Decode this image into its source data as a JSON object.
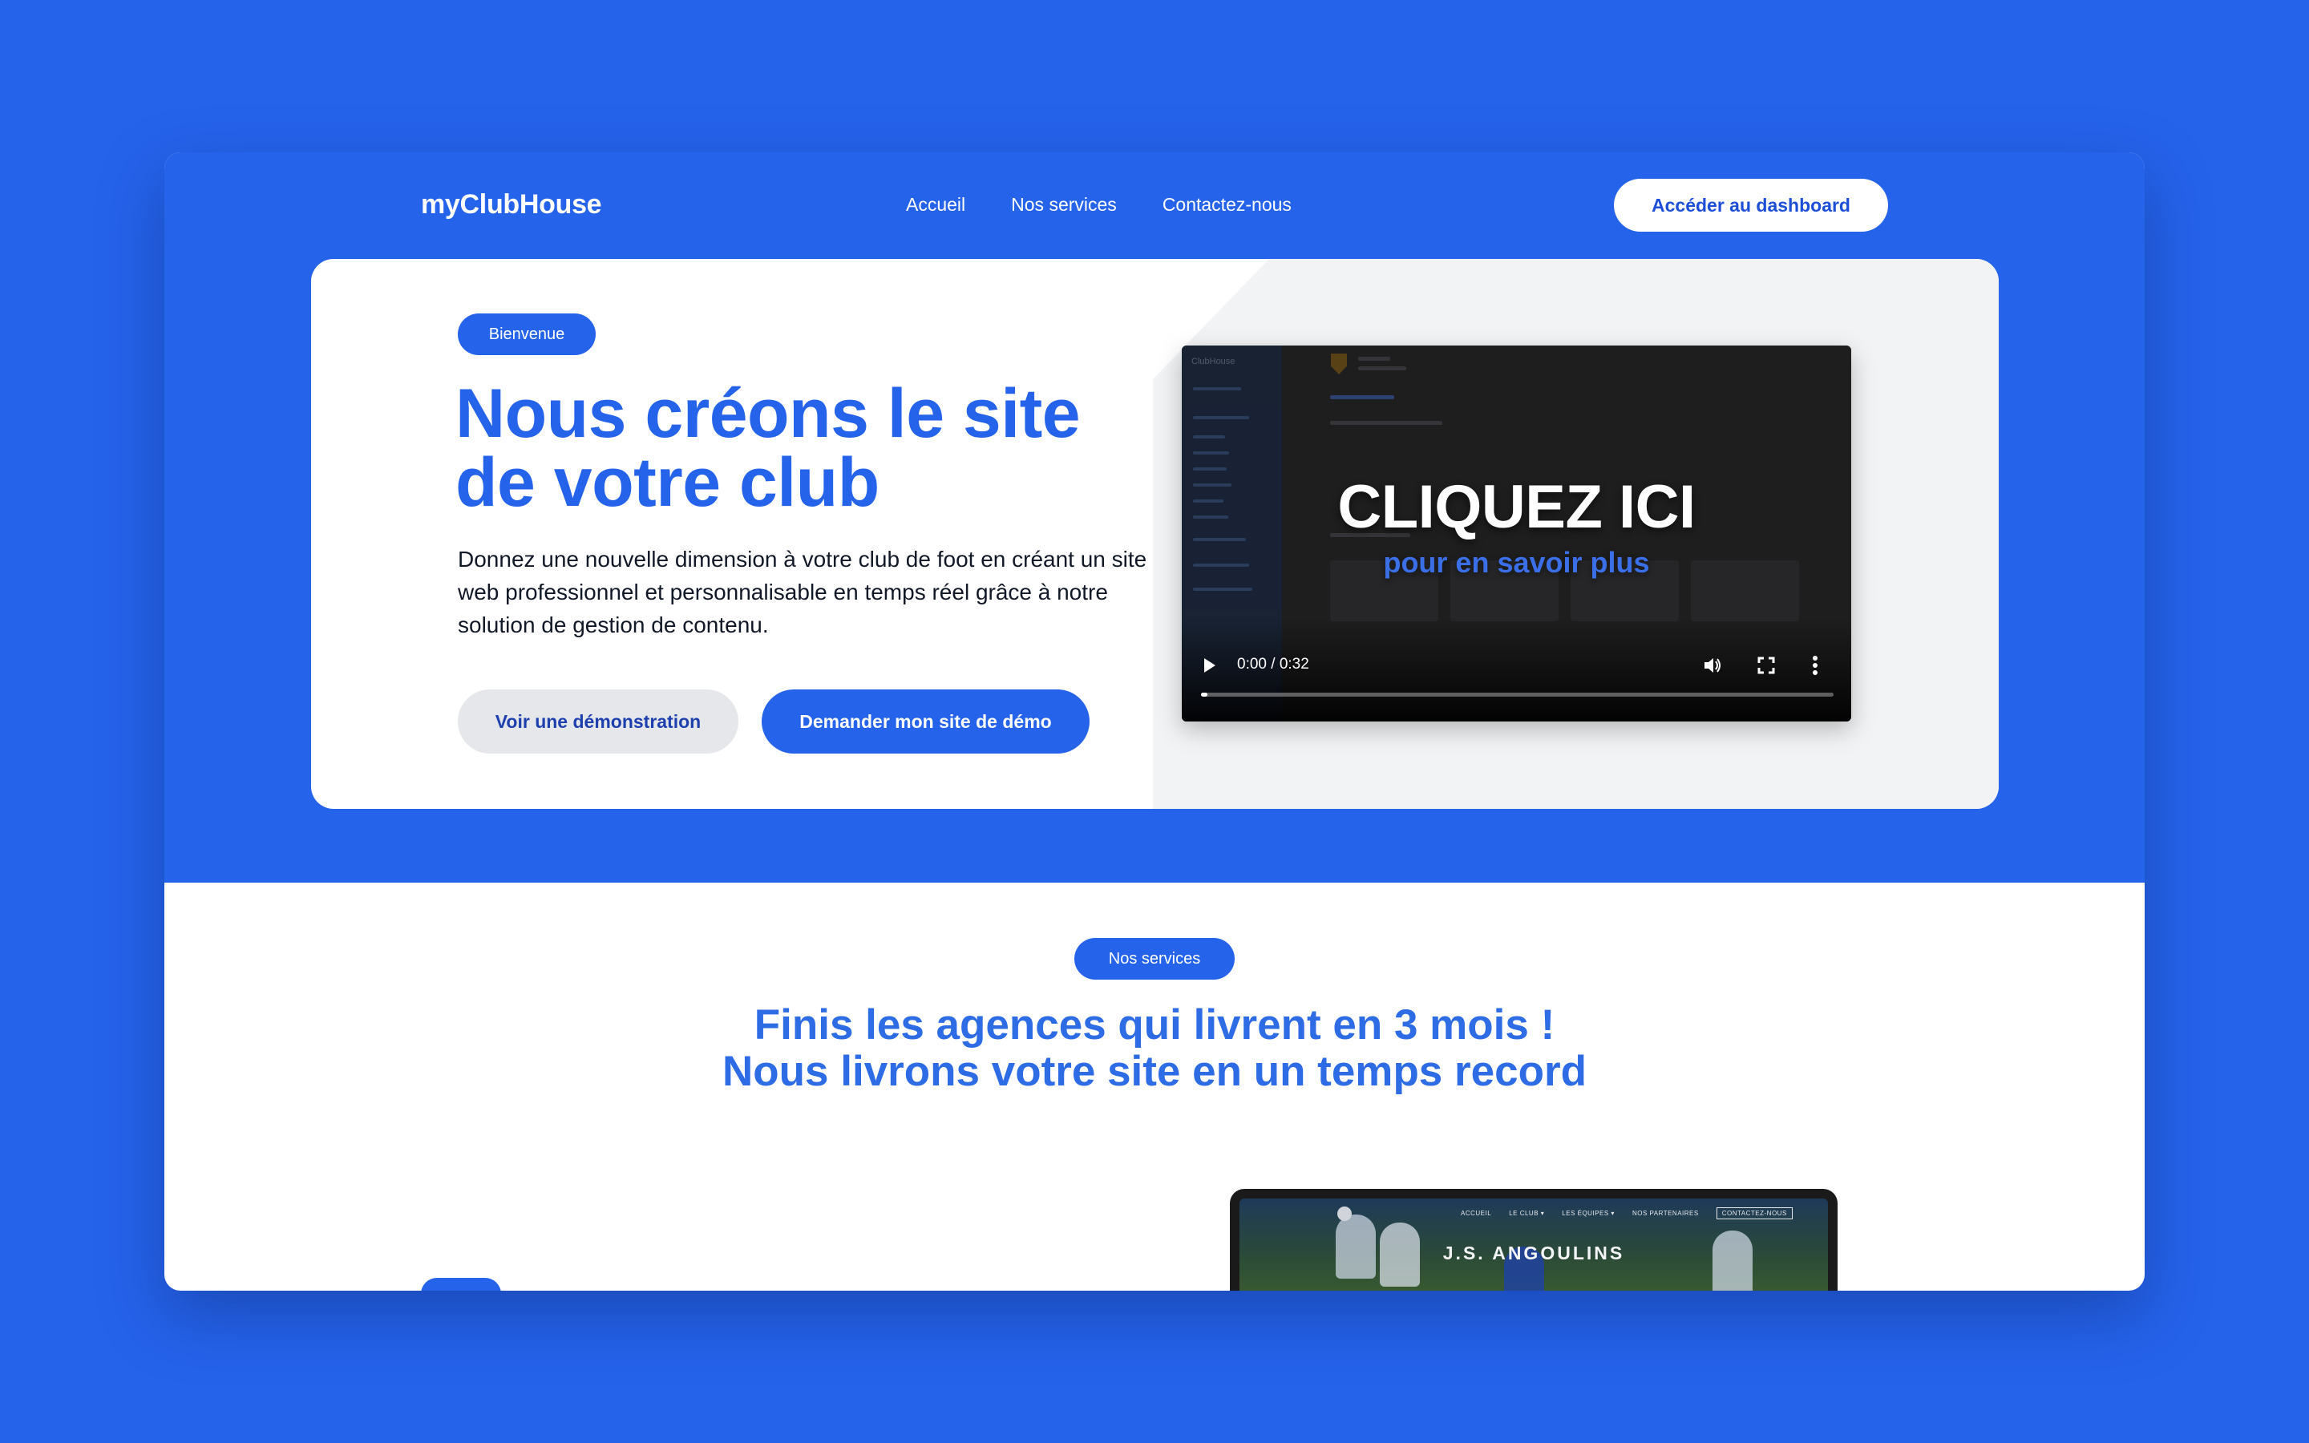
{
  "nav": {
    "logo": "myClubHouse",
    "links": [
      "Accueil",
      "Nos services",
      "Contactez-nous"
    ],
    "cta": "Accéder au dashboard"
  },
  "hero": {
    "badge": "Bienvenue",
    "title_line1": "Nous créons le site",
    "title_line2": "de votre club",
    "description": "Donnez une nouvelle dimension à votre club de foot en créant un site web professionnel et personnalisable en temps réel grâce à notre solution de gestion de contenu.",
    "btn_demo": "Voir une démonstration",
    "btn_request": "Demander mon site de démo"
  },
  "video": {
    "title": "CLIQUEZ ICI",
    "subtitle": "pour en savoir plus",
    "time": "0:00 / 0:32",
    "progress": 0.0,
    "thumbnail": {
      "sidebar_title": "ClubHouse"
    },
    "icons": [
      "play-icon",
      "volume-icon",
      "fullscreen-icon",
      "more-options-icon"
    ]
  },
  "services": {
    "badge": "Nos services",
    "title_line1": "Finis les agences qui livrent en 3 mois !",
    "title_line2": "Nous livrons votre site en un temps record"
  },
  "laptop_preview": {
    "site_title": "J.S. ANGOULINS",
    "nav": [
      "ACCUEIL",
      "LE CLUB ▾",
      "LES ÉQUIPES ▾",
      "NOS PARTENAIRES",
      "CONTACTEZ-NOUS"
    ]
  },
  "colors": {
    "brand_blue": "#2563EB",
    "title_blue": "#2E6CE6",
    "button_gray": "#E5E7EB"
  }
}
